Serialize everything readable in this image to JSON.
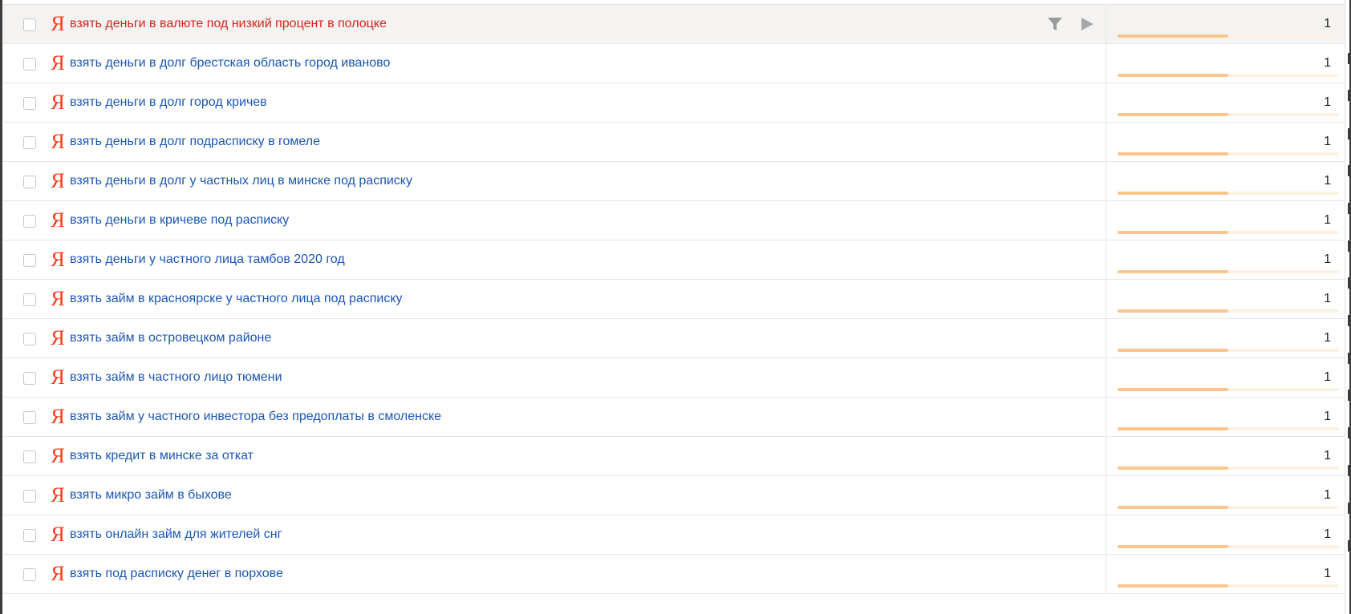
{
  "colors": {
    "link": "#1a56b6",
    "active_link": "#d8231b",
    "yandex_icon": "#ff3a1a",
    "bar_fill": "#fbc58c",
    "bar_track": "#fdf1e3",
    "highlight_row": "#f4f3f2"
  },
  "icons": {
    "yandex": "Я",
    "filter": "filter-icon",
    "play": "play-icon"
  },
  "rows": [
    {
      "phrase": "взять деньги в валюте под низкий процент в полоцке",
      "count": "1",
      "share": 0.5,
      "active": true
    },
    {
      "phrase": "взять деньги в долг брестская область город иваново",
      "count": "1",
      "share": 0.5,
      "active": false
    },
    {
      "phrase": "взять деньги в долг город кричев",
      "count": "1",
      "share": 0.5,
      "active": false
    },
    {
      "phrase": "взять деньги в долг подрасписку в гомеле",
      "count": "1",
      "share": 0.5,
      "active": false
    },
    {
      "phrase": "взять деньги в долг у частных лиц в минске под расписку",
      "count": "1",
      "share": 0.5,
      "active": false
    },
    {
      "phrase": "взять деньги в кричеве под расписку",
      "count": "1",
      "share": 0.5,
      "active": false
    },
    {
      "phrase": "взять деньги у частного лица тамбов 2020 год",
      "count": "1",
      "share": 0.5,
      "active": false
    },
    {
      "phrase": "взять займ в красноярске у частного лица под расписку",
      "count": "1",
      "share": 0.5,
      "active": false
    },
    {
      "phrase": "взять займ в островецком районе",
      "count": "1",
      "share": 0.5,
      "active": false
    },
    {
      "phrase": "взять займ в частного лицо тюмени",
      "count": "1",
      "share": 0.5,
      "active": false
    },
    {
      "phrase": "взять займ у частного инвестора без предоплаты в смоленске",
      "count": "1",
      "share": 0.5,
      "active": false
    },
    {
      "phrase": "взять кредит в минске за откат",
      "count": "1",
      "share": 0.5,
      "active": false
    },
    {
      "phrase": "взять микро займ в быхове",
      "count": "1",
      "share": 0.5,
      "active": false
    },
    {
      "phrase": "взять онлайн займ для жителей снг",
      "count": "1",
      "share": 0.5,
      "active": false
    },
    {
      "phrase": "взять под расписку денег в порхове",
      "count": "1",
      "share": 0.5,
      "active": false
    }
  ]
}
